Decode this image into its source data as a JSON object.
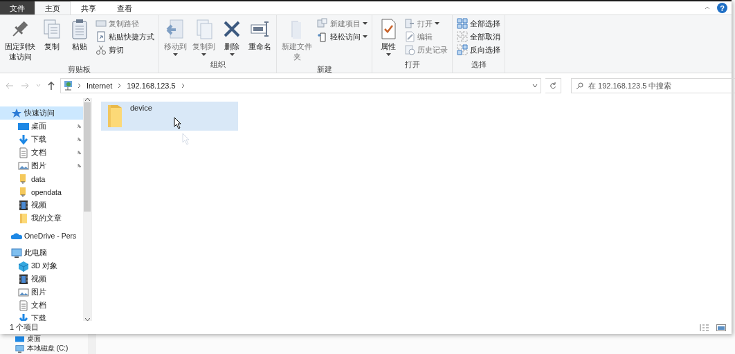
{
  "tabs": [
    {
      "label": "文件",
      "kind": "file",
      "selected": false
    },
    {
      "label": "主页",
      "kind": "tab",
      "selected": true
    },
    {
      "label": "共享",
      "kind": "tab",
      "selected": false
    },
    {
      "label": "查看",
      "kind": "tab",
      "selected": false
    }
  ],
  "help": "?",
  "ribbon": {
    "groups": [
      {
        "label": "剪贴板",
        "items": [
          {
            "kind": "large",
            "label": "固定到快速访问",
            "disabled": false,
            "dropdown": false
          },
          {
            "kind": "large",
            "label": "复制",
            "disabled": false,
            "dropdown": false
          },
          {
            "kind": "large",
            "label": "粘贴",
            "disabled": false,
            "dropdown": false
          },
          {
            "kind": "small",
            "label": "复制路径",
            "disabled": true,
            "dropdown": false
          },
          {
            "kind": "small",
            "label": "粘贴快捷方式",
            "disabled": false,
            "dropdown": false
          },
          {
            "kind": "small",
            "label": "剪切",
            "disabled": false,
            "dropdown": false
          }
        ]
      },
      {
        "label": "组织",
        "items": [
          {
            "kind": "large",
            "label": "移动到",
            "disabled": true,
            "dropdown": true
          },
          {
            "kind": "large",
            "label": "复制到",
            "disabled": true,
            "dropdown": true
          },
          {
            "kind": "large",
            "label": "删除",
            "disabled": false,
            "dropdown": true
          },
          {
            "kind": "large",
            "label": "重命名",
            "disabled": false,
            "dropdown": false
          }
        ]
      },
      {
        "label": "新建",
        "items": [
          {
            "kind": "large",
            "label": "新建文件夹",
            "disabled": true,
            "dropdown": false
          },
          {
            "kind": "small",
            "label": "新建项目",
            "disabled": true,
            "dropdown": true
          },
          {
            "kind": "small",
            "label": "轻松访问",
            "disabled": false,
            "dropdown": true
          }
        ]
      },
      {
        "label": "打开",
        "items": [
          {
            "kind": "large",
            "label": "属性",
            "disabled": false,
            "dropdown": true
          },
          {
            "kind": "small",
            "label": "打开",
            "disabled": true,
            "dropdown": true
          },
          {
            "kind": "small",
            "label": "编辑",
            "disabled": true,
            "dropdown": false
          },
          {
            "kind": "small",
            "label": "历史记录",
            "disabled": true,
            "dropdown": false
          }
        ]
      },
      {
        "label": "选择",
        "items": [
          {
            "kind": "small",
            "label": "全部选择",
            "disabled": false,
            "dropdown": false
          },
          {
            "kind": "small",
            "label": "全部取消",
            "disabled": false,
            "dropdown": false
          },
          {
            "kind": "small",
            "label": "反向选择",
            "disabled": false,
            "dropdown": false
          }
        ]
      }
    ]
  },
  "address": {
    "crumbs": [
      "Internet",
      "192.168.123.5"
    ]
  },
  "search": {
    "placeholder": "在 192.168.123.5 中搜索"
  },
  "sidebar": {
    "items": [
      {
        "label": "快速访问",
        "selected": true,
        "children": [
          {
            "label": "桌面",
            "pinned": true,
            "selected": false
          },
          {
            "label": "下载",
            "pinned": true,
            "selected": false
          },
          {
            "label": "文档",
            "pinned": true,
            "selected": false
          },
          {
            "label": "图片",
            "pinned": true,
            "selected": false
          },
          {
            "label": "data",
            "pinned": false,
            "selected": false
          },
          {
            "label": "opendata",
            "pinned": false,
            "selected": false
          },
          {
            "label": "视频",
            "pinned": false,
            "selected": false
          },
          {
            "label": "我的文章",
            "pinned": false,
            "selected": false
          }
        ]
      },
      {
        "label": "OneDrive - Pers",
        "selected": false
      },
      {
        "label": "此电脑",
        "selected": false,
        "children": [
          {
            "label": "3D 对象",
            "pinned": false,
            "selected": false
          },
          {
            "label": "视频",
            "pinned": false,
            "selected": false
          },
          {
            "label": "图片",
            "pinned": false,
            "selected": false
          },
          {
            "label": "文档",
            "pinned": false,
            "selected": false
          },
          {
            "label": "下载",
            "pinned": false,
            "selected": false
          }
        ]
      }
    ]
  },
  "files": [
    {
      "name": "device",
      "selected": true
    }
  ],
  "status_bar": {
    "count": "1 个项目"
  },
  "background_window": {
    "items": [
      "桌面",
      "本地磁盘 (C:)"
    ]
  }
}
